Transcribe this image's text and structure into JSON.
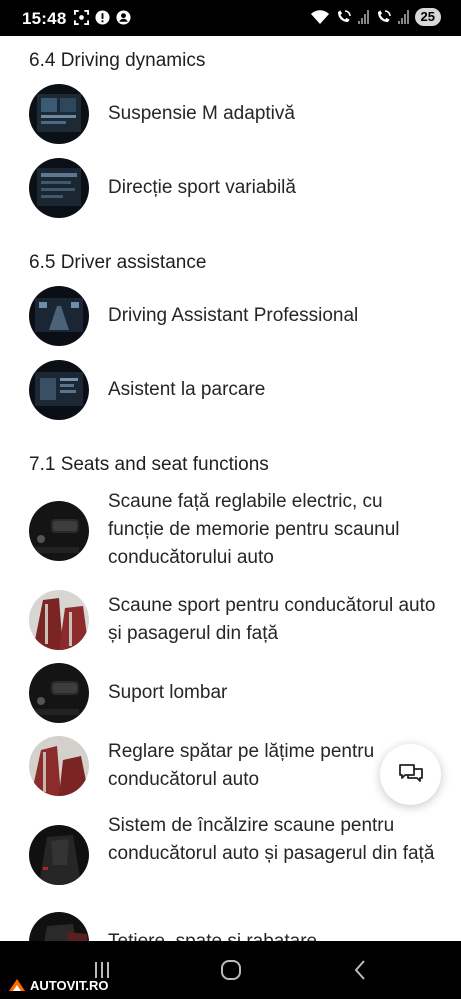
{
  "status_bar": {
    "time": "15:48",
    "battery": "25",
    "left_icons": [
      "screenshot-icon",
      "alert-icon",
      "account-icon"
    ],
    "right_icons": [
      "wifi-icon",
      "wifi-call-icon",
      "signal-icon",
      "wifi-call-icon",
      "signal-icon"
    ]
  },
  "sections": [
    {
      "title": "6.4 Driving dynamics",
      "items": [
        {
          "label": "Suspensie M adaptivă",
          "thumb": "screen-thumbnail"
        },
        {
          "label": "Direcție sport variabilă",
          "thumb": "screen-thumbnail"
        }
      ]
    },
    {
      "title": "6.5 Driver assistance",
      "items": [
        {
          "label": "Driving Assistant Professional",
          "thumb": "screen-thumbnail"
        },
        {
          "label": "Asistent la parcare",
          "thumb": "screen-thumbnail"
        }
      ]
    },
    {
      "title": "7.1 Seats and seat functions",
      "items": [
        {
          "label": "Scaune față reglabile electric, cu funcție de memorie pentru scaunul conducătorului auto",
          "thumb": "seat-controls-thumbnail"
        },
        {
          "label": "Scaune sport pentru conducătorul auto și pasagerul din față",
          "thumb": "leather-seat-thumbnail"
        },
        {
          "label": "Suport lombar",
          "thumb": "seat-controls-thumbnail"
        },
        {
          "label": "Reglare spătar pe lățime pentru conducătorul auto",
          "thumb": "leather-seat-thumbnail"
        },
        {
          "label": "Sistem de încălzire scaune pentru conducătorul auto și pasagerul din față",
          "thumb": "dark-seat-thumbnail"
        },
        {
          "label": "Tetiere, spate și rabatare",
          "thumb": "dark-seat-thumbnail"
        }
      ]
    }
  ],
  "chat_button": {
    "icon": "chat-icon"
  },
  "nav_bar": {
    "buttons": [
      "recent-apps-icon",
      "home-icon",
      "back-icon"
    ]
  },
  "watermark": {
    "text": "AUTOVIT.RO"
  },
  "colors": {
    "status_bg": "#000000",
    "page_bg": "#ffffff",
    "text": "#262626",
    "seat_red": "#8b2b2b"
  }
}
